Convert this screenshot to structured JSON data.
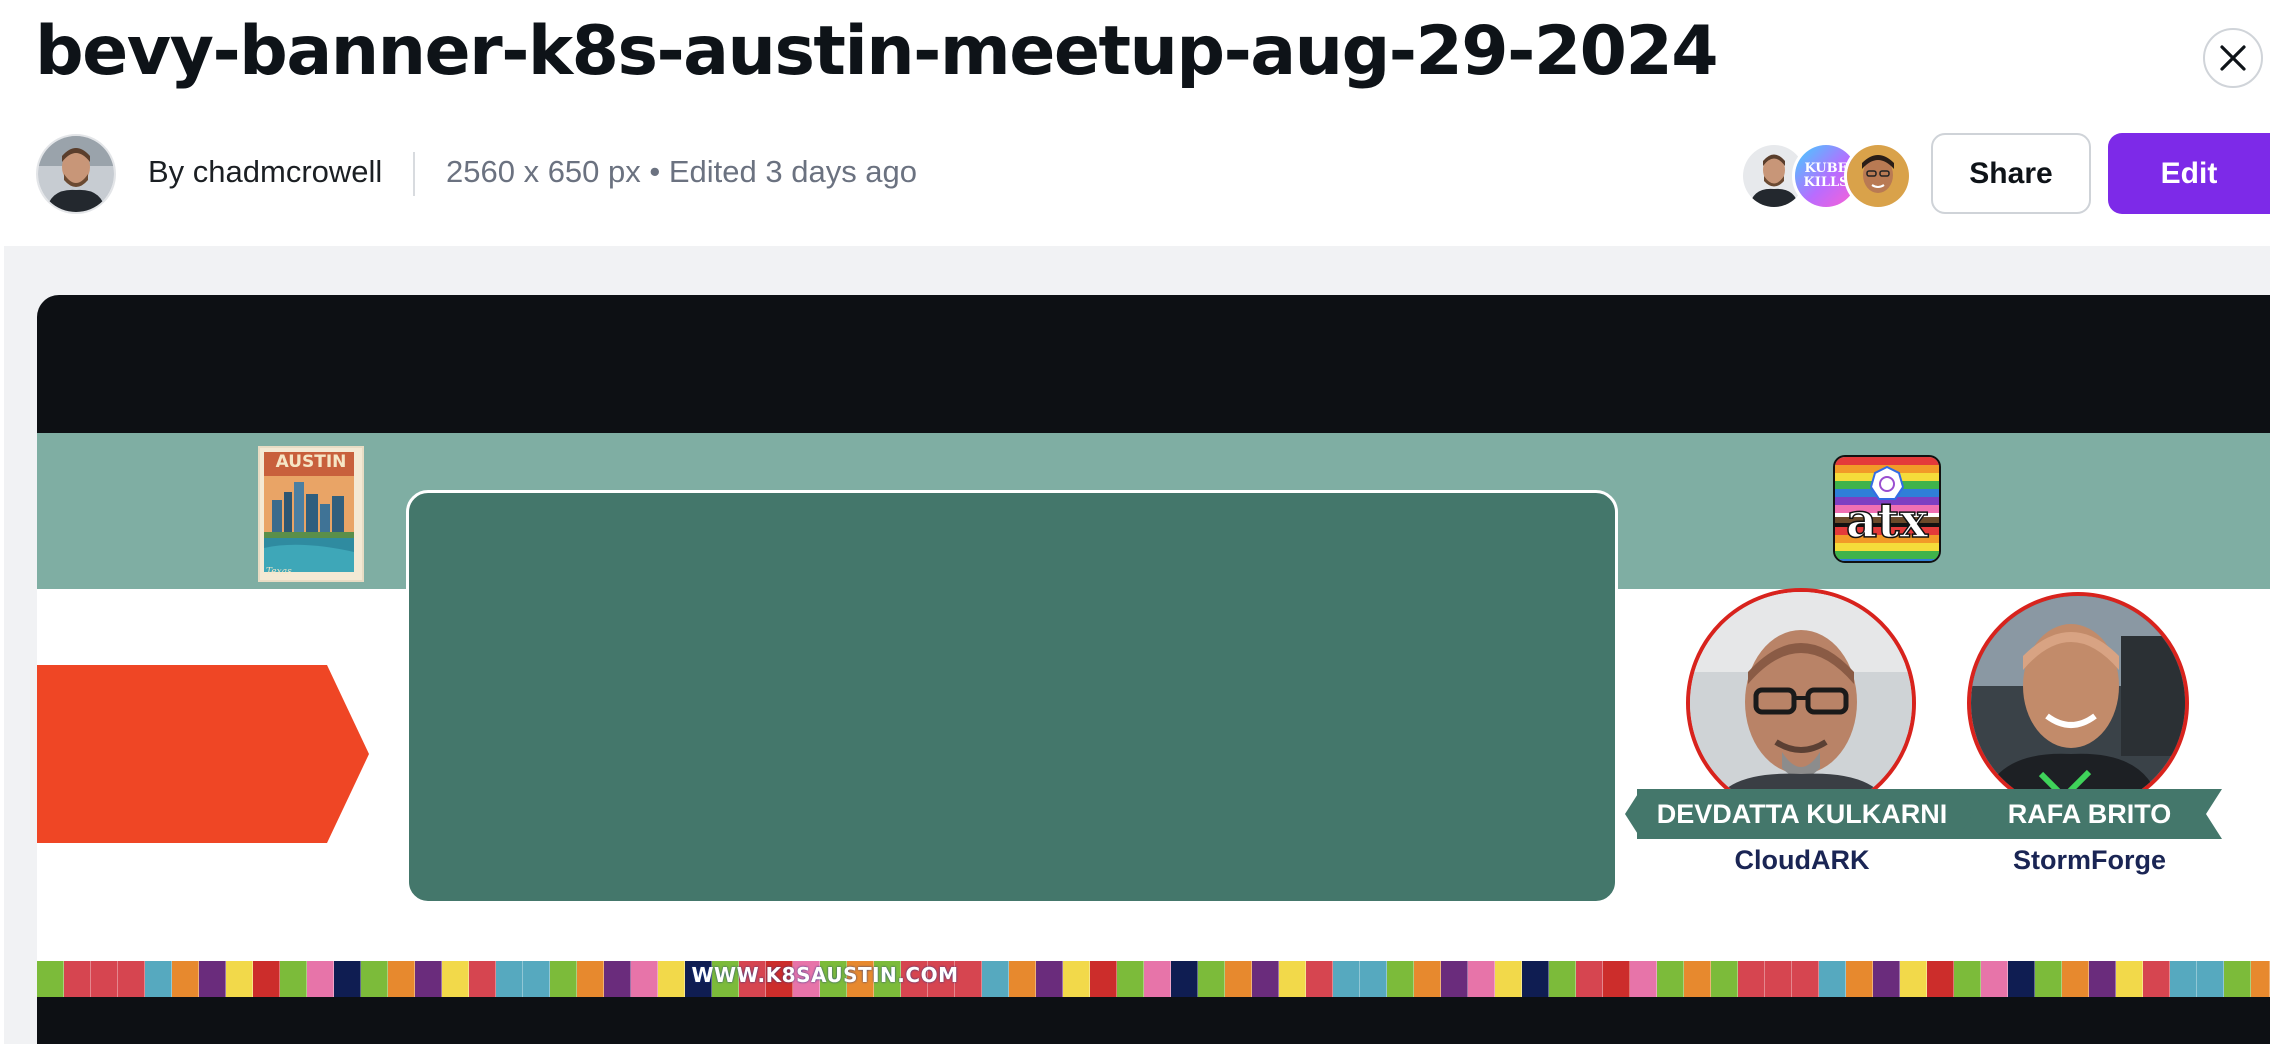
{
  "header": {
    "title": "bevy-banner-k8s-austin-meetup-aug-29-2024",
    "byline": "By chadmcrowell",
    "meta": "2560 x 650 px • Edited 3 days ago",
    "share_label": "Share",
    "edit_label": "Edit",
    "accent_color": "#7d2ae8"
  },
  "collaborators": [
    {
      "icon": "avatar-chadmcrowell"
    },
    {
      "text": "KUBE KILLS"
    },
    {
      "icon": "avatar-collaborator"
    }
  ],
  "design": {
    "postcard_title": "AUSTIN",
    "postcard_caption": "Texas",
    "logo_text": "atx",
    "url": "WWW.K8SAUSTIN.COM",
    "speakers": [
      {
        "name": "DEVDATTA KULKARNI",
        "company": "CloudARK"
      },
      {
        "name": "RAFA BRITO",
        "company": "StormForge"
      }
    ],
    "colors": {
      "top": "#0d1014",
      "band": "#7faea3",
      "panel": "#44776b",
      "arrow": "#ef4625",
      "ring": "#d8231d"
    }
  }
}
